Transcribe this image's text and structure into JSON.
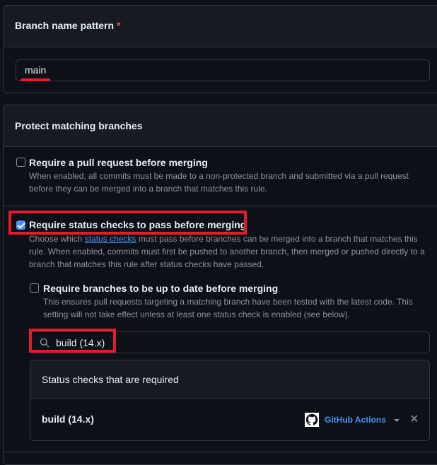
{
  "branch_pattern": {
    "label": "Branch name pattern",
    "required_marker": "*",
    "value": "main"
  },
  "protect": {
    "title": "Protect matching branches",
    "options": [
      {
        "label": "Require a pull request before merging",
        "checked": false,
        "description": "When enabled, all commits must be made to a non-protected branch and submitted via a pull request before they can be merged into a branch that matches this rule."
      },
      {
        "label": "Require status checks to pass before merging",
        "checked": true,
        "description_pre": "Choose which ",
        "description_link": "status checks",
        "description_post": " must pass before branches can be merged into a branch that matches this rule. When enabled, commits must first be pushed to another branch, then merged or pushed directly to a branch that matches this rule after status checks have passed."
      }
    ],
    "sub_option": {
      "label": "Require branches to be up to date before merging",
      "checked": false,
      "description": "This ensures pull requests targeting a matching branch have been tested with the latest code. This setting will not take effect unless at least one status check is enabled (see below)."
    },
    "search": {
      "value": "build (14.x)",
      "icon": "search-icon"
    },
    "status_checks": {
      "header": "Status checks that are required",
      "items": [
        {
          "name": "build (14.x)",
          "app": "GitHub Actions",
          "app_icon": "github-icon"
        }
      ]
    }
  },
  "colors": {
    "background": "#0d1117",
    "panel": "#161b22",
    "border": "#30363d",
    "accent": "#4493f8",
    "highlight": "#e11d2a"
  }
}
